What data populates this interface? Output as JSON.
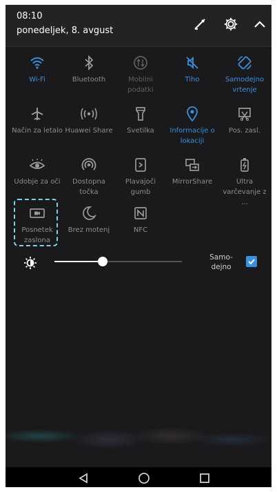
{
  "status": {
    "time": "08:10",
    "date": "ponedeljek, 8. avgust"
  },
  "top_icons": [
    "edit-icon",
    "settings-icon",
    "collapse-icon"
  ],
  "tiles": [
    {
      "id": "wifi",
      "label": "Wi-Fi",
      "state": "active"
    },
    {
      "id": "bluetooth",
      "label": "Bluetooth",
      "state": "off"
    },
    {
      "id": "mobile-data",
      "label": "Mobilni podatki",
      "state": "disabled"
    },
    {
      "id": "silent",
      "label": "Tiho",
      "state": "active"
    },
    {
      "id": "auto-rotate",
      "label": "Samodejno vrtenje",
      "state": "active"
    },
    {
      "id": "airplane",
      "label": "Način za letalo",
      "state": "off"
    },
    {
      "id": "huawei-share",
      "label": "Huawei Share",
      "state": "off"
    },
    {
      "id": "flashlight",
      "label": "Svetilka",
      "state": "off"
    },
    {
      "id": "location",
      "label": "Informacije o lokaciji",
      "state": "active"
    },
    {
      "id": "screenshot",
      "label": "Pos. zasl.",
      "state": "off"
    },
    {
      "id": "eye-comfort",
      "label": "Udobje za oči",
      "state": "off"
    },
    {
      "id": "hotspot",
      "label": "Dostopna točka",
      "state": "off"
    },
    {
      "id": "floating-dock",
      "label": "Plavajoči gumb",
      "state": "off"
    },
    {
      "id": "mirrorshare",
      "label": "MirrorShare",
      "state": "off"
    },
    {
      "id": "ultra-power",
      "label": "Ultra varčevanje z ...",
      "state": "off"
    },
    {
      "id": "screen-record",
      "label": "Posnetek zaslona",
      "state": "off"
    },
    {
      "id": "do-not-disturb",
      "label": "Brez motenj",
      "state": "off"
    },
    {
      "id": "nfc",
      "label": "NFC",
      "state": "off"
    }
  ],
  "brightness": {
    "level": 0.38,
    "auto_label": "Samo-dejno",
    "auto_checked": true
  },
  "colors": {
    "accent": "#3b8fde",
    "panel": "#1a1a1c",
    "label": "#8e8e8e",
    "highlight": "#7fd2ea"
  },
  "nav": [
    "back-icon",
    "home-icon",
    "recents-icon"
  ]
}
